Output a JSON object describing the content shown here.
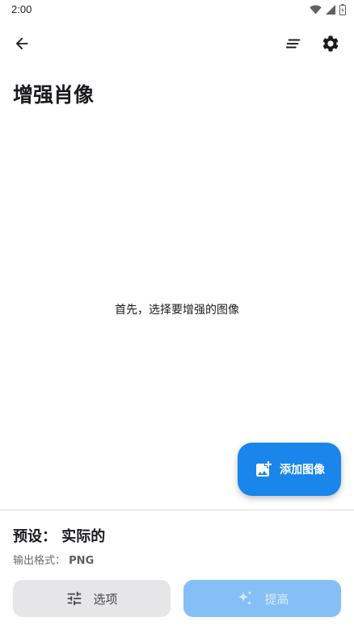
{
  "status_bar": {
    "time": "2:00",
    "icons": [
      "wifi-icon",
      "cell-signal-icon",
      "battery-icon"
    ]
  },
  "app_bar": {
    "icons": [
      "back-arrow-icon",
      "list-icon",
      "gear-icon"
    ]
  },
  "page": {
    "title": "增强肖像",
    "empty_hint": "首先，选择要增强的图像"
  },
  "fab": {
    "label": "添加图像",
    "icon": "add-photo-icon",
    "color": "#1a85ea"
  },
  "footer": {
    "preset_text": "预设： 实际的",
    "format_label": "输出格式：",
    "format_value": "PNG"
  },
  "buttons": {
    "options_label": "选项",
    "options_icon": "sliders-icon",
    "enhance_label": "提高",
    "enhance_icon": "sparkle-icon",
    "enhance_color": "#85bff6"
  }
}
